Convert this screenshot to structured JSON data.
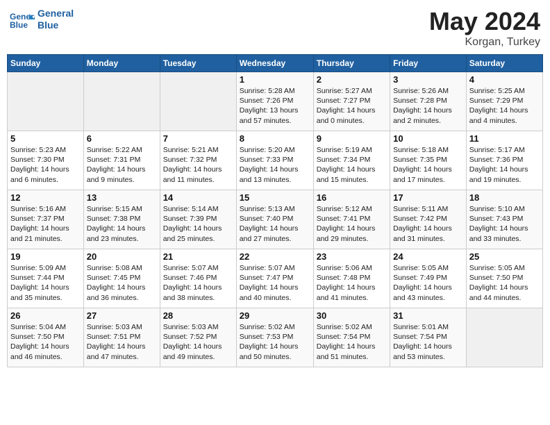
{
  "header": {
    "logo_general": "General",
    "logo_blue": "Blue",
    "title": "May 2024",
    "subtitle": "Korgan, Turkey"
  },
  "weekdays": [
    "Sunday",
    "Monday",
    "Tuesday",
    "Wednesday",
    "Thursday",
    "Friday",
    "Saturday"
  ],
  "weeks": [
    [
      {
        "day": "",
        "info": ""
      },
      {
        "day": "",
        "info": ""
      },
      {
        "day": "",
        "info": ""
      },
      {
        "day": "1",
        "info": "Sunrise: 5:28 AM\nSunset: 7:26 PM\nDaylight: 13 hours and 57 minutes."
      },
      {
        "day": "2",
        "info": "Sunrise: 5:27 AM\nSunset: 7:27 PM\nDaylight: 14 hours and 0 minutes."
      },
      {
        "day": "3",
        "info": "Sunrise: 5:26 AM\nSunset: 7:28 PM\nDaylight: 14 hours and 2 minutes."
      },
      {
        "day": "4",
        "info": "Sunrise: 5:25 AM\nSunset: 7:29 PM\nDaylight: 14 hours and 4 minutes."
      }
    ],
    [
      {
        "day": "5",
        "info": "Sunrise: 5:23 AM\nSunset: 7:30 PM\nDaylight: 14 hours and 6 minutes."
      },
      {
        "day": "6",
        "info": "Sunrise: 5:22 AM\nSunset: 7:31 PM\nDaylight: 14 hours and 9 minutes."
      },
      {
        "day": "7",
        "info": "Sunrise: 5:21 AM\nSunset: 7:32 PM\nDaylight: 14 hours and 11 minutes."
      },
      {
        "day": "8",
        "info": "Sunrise: 5:20 AM\nSunset: 7:33 PM\nDaylight: 14 hours and 13 minutes."
      },
      {
        "day": "9",
        "info": "Sunrise: 5:19 AM\nSunset: 7:34 PM\nDaylight: 14 hours and 15 minutes."
      },
      {
        "day": "10",
        "info": "Sunrise: 5:18 AM\nSunset: 7:35 PM\nDaylight: 14 hours and 17 minutes."
      },
      {
        "day": "11",
        "info": "Sunrise: 5:17 AM\nSunset: 7:36 PM\nDaylight: 14 hours and 19 minutes."
      }
    ],
    [
      {
        "day": "12",
        "info": "Sunrise: 5:16 AM\nSunset: 7:37 PM\nDaylight: 14 hours and 21 minutes."
      },
      {
        "day": "13",
        "info": "Sunrise: 5:15 AM\nSunset: 7:38 PM\nDaylight: 14 hours and 23 minutes."
      },
      {
        "day": "14",
        "info": "Sunrise: 5:14 AM\nSunset: 7:39 PM\nDaylight: 14 hours and 25 minutes."
      },
      {
        "day": "15",
        "info": "Sunrise: 5:13 AM\nSunset: 7:40 PM\nDaylight: 14 hours and 27 minutes."
      },
      {
        "day": "16",
        "info": "Sunrise: 5:12 AM\nSunset: 7:41 PM\nDaylight: 14 hours and 29 minutes."
      },
      {
        "day": "17",
        "info": "Sunrise: 5:11 AM\nSunset: 7:42 PM\nDaylight: 14 hours and 31 minutes."
      },
      {
        "day": "18",
        "info": "Sunrise: 5:10 AM\nSunset: 7:43 PM\nDaylight: 14 hours and 33 minutes."
      }
    ],
    [
      {
        "day": "19",
        "info": "Sunrise: 5:09 AM\nSunset: 7:44 PM\nDaylight: 14 hours and 35 minutes."
      },
      {
        "day": "20",
        "info": "Sunrise: 5:08 AM\nSunset: 7:45 PM\nDaylight: 14 hours and 36 minutes."
      },
      {
        "day": "21",
        "info": "Sunrise: 5:07 AM\nSunset: 7:46 PM\nDaylight: 14 hours and 38 minutes."
      },
      {
        "day": "22",
        "info": "Sunrise: 5:07 AM\nSunset: 7:47 PM\nDaylight: 14 hours and 40 minutes."
      },
      {
        "day": "23",
        "info": "Sunrise: 5:06 AM\nSunset: 7:48 PM\nDaylight: 14 hours and 41 minutes."
      },
      {
        "day": "24",
        "info": "Sunrise: 5:05 AM\nSunset: 7:49 PM\nDaylight: 14 hours and 43 minutes."
      },
      {
        "day": "25",
        "info": "Sunrise: 5:05 AM\nSunset: 7:50 PM\nDaylight: 14 hours and 44 minutes."
      }
    ],
    [
      {
        "day": "26",
        "info": "Sunrise: 5:04 AM\nSunset: 7:50 PM\nDaylight: 14 hours and 46 minutes."
      },
      {
        "day": "27",
        "info": "Sunrise: 5:03 AM\nSunset: 7:51 PM\nDaylight: 14 hours and 47 minutes."
      },
      {
        "day": "28",
        "info": "Sunrise: 5:03 AM\nSunset: 7:52 PM\nDaylight: 14 hours and 49 minutes."
      },
      {
        "day": "29",
        "info": "Sunrise: 5:02 AM\nSunset: 7:53 PM\nDaylight: 14 hours and 50 minutes."
      },
      {
        "day": "30",
        "info": "Sunrise: 5:02 AM\nSunset: 7:54 PM\nDaylight: 14 hours and 51 minutes."
      },
      {
        "day": "31",
        "info": "Sunrise: 5:01 AM\nSunset: 7:54 PM\nDaylight: 14 hours and 53 minutes."
      },
      {
        "day": "",
        "info": ""
      }
    ]
  ]
}
